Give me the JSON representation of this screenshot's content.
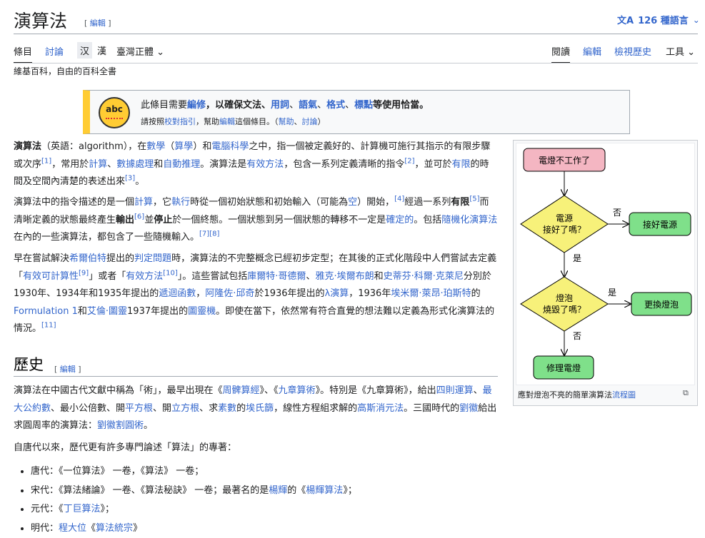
{
  "header": {
    "title": "演算法",
    "title_edit": "編輯",
    "languages": "126 種語言"
  },
  "tabs_left": {
    "article": "條目",
    "talk": "討論",
    "variant_a": "汉",
    "variant_b": "漢",
    "variant_select": "臺灣正體"
  },
  "tabs_right": {
    "read": "閱讀",
    "edit": "編輯",
    "history": "檢視歷史",
    "tools": "工具"
  },
  "from_wiki": "維基百科，自由的百科全書",
  "ambox": {
    "icon_text": "abc",
    "main": [
      "此條目需要",
      "編修",
      "，以確保文法、",
      "用詞",
      "、",
      "語氣",
      "、",
      "格式",
      "、",
      "標點",
      "等使用恰當。"
    ],
    "sub": [
      "請按照",
      "校對指引",
      "，幫助",
      "編輯",
      "這個條目。（",
      "幫助",
      "、",
      "討論",
      "）"
    ]
  },
  "paragraphs": {
    "p1": [
      "演算法",
      "（英語：algorithm），在",
      "數學",
      "（",
      "算學",
      "）和",
      "電腦科學",
      "之中，指一個被定義好的、計算機可施行其指示的有限步驟或次序",
      "[1]",
      "，常用於",
      "計算",
      "、",
      "數據處理",
      "和",
      "自動推理",
      "。演算法是",
      "有效方法",
      "，包含一系列定義清晰的指令",
      "[2]",
      "，並可於",
      "有限",
      "的時間及空間內清楚的表述出來",
      "[3]",
      "。"
    ],
    "p2": [
      "演算法中的指令描述的是一個",
      "計算",
      "，它",
      "執行",
      "時從一個初始狀態和初始輸入（可能為",
      "空",
      "）開始，",
      "[4]",
      "經過一系列",
      "有限",
      "[5]",
      "而清晰定義的狀態最終產生",
      "輸出",
      "[6]",
      "並",
      "停止",
      "於一個終態。一個狀態到另一個狀態的轉移不一定是",
      "確定的",
      "。包括",
      "隨機化演算法",
      "在內的一些演算法，都包含了一些隨機輸入。",
      "[7]",
      "[8]"
    ],
    "p3": [
      "早在嘗試解決",
      "希爾伯特",
      "提出的",
      "判定問題",
      "時，演算法的不完整概念已經初步定型；在其後的正式化階段中人們嘗試去定義「",
      "有效可計算性",
      "[9]",
      "」或者「",
      "有效方法",
      "[10]",
      "」。這些嘗試包括",
      "庫爾特·哥德爾",
      "、",
      "雅克·埃爾布朗",
      "和",
      "史蒂芬·科爾·克萊尼",
      "分別於1930年、1934年和1935年提出的",
      "遞迴函數",
      "，",
      "阿隆佐·邱奇",
      "於1936年提出的",
      "λ演算",
      "，1936年",
      "埃米爾·萊昂·珀斯特",
      "的",
      "Formulation 1",
      "和",
      "艾倫·圖靈",
      "1937年提出的",
      "圖靈機",
      "。即使在當下，依然常有符合直覺的想法難以定義為形式化演算法的情況。",
      "[11]"
    ]
  },
  "history": {
    "heading": "歷史",
    "edit": "編輯",
    "p1": [
      "演算法在中國古代文獻中稱為「術」，最早出現在《",
      "周髀算經",
      "》、《",
      "九章算術",
      "》。特別是《九章算術》，給出",
      "四則運算",
      "、",
      "最大公約數",
      "、最小公倍數、開",
      "平方根",
      "、開",
      "立方根",
      "、求",
      "素數",
      "的",
      "埃氏篩",
      "，線性方程組求解的",
      "高斯消元法",
      "。三國時代的",
      "劉徽",
      "給出求圓周率的演算法：",
      "劉徽割圓術",
      "。"
    ],
    "p2": "自唐代以來，歷代更有許多專門論述「算法」的專著：",
    "list": [
      [
        "唐代：《一位算法》 一卷，《算法》 一卷；"
      ],
      [
        "宋代：《算法緒論》 一卷、《算法秘訣》 一卷；最著名的是",
        "楊輝",
        "的《",
        "楊輝算法",
        "》；"
      ],
      [
        "元代：《",
        "丁巨算法",
        "》；"
      ],
      [
        "明代：",
        "程大位",
        "《",
        "算法統宗",
        "》"
      ]
    ]
  },
  "figure": {
    "caption_prefix": "應對燈泡不亮的簡單演算法",
    "caption_link": "流程圖",
    "nodes": {
      "start": "電燈不工作了",
      "q1_line1": "電源",
      "q1_line2": "接好了嗎？",
      "a1": "接好電源",
      "q2_line1": "燈泡",
      "q2_line2": "燒毀了嗎？",
      "a2": "更換燈泡",
      "end": "修理電燈"
    },
    "labels": {
      "no1": "否",
      "yes1": "是",
      "yes2": "是",
      "no2": "否"
    }
  }
}
